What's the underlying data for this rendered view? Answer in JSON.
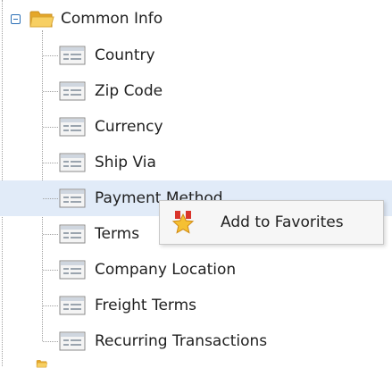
{
  "tree": {
    "root": {
      "label": "Common Info",
      "expanded": true,
      "icon": "folder-open-icon"
    },
    "children": [
      {
        "label": "Country",
        "icon": "form-icon"
      },
      {
        "label": "Zip Code",
        "icon": "form-icon"
      },
      {
        "label": "Currency",
        "icon": "form-icon"
      },
      {
        "label": "Ship Via",
        "icon": "form-icon"
      },
      {
        "label": "Payment Method",
        "icon": "form-icon",
        "selected": true
      },
      {
        "label": "Terms",
        "icon": "form-icon"
      },
      {
        "label": "Company Location",
        "icon": "form-icon"
      },
      {
        "label": "Freight Terms",
        "icon": "form-icon"
      },
      {
        "label": "Recurring Transactions",
        "icon": "form-icon"
      }
    ]
  },
  "context_menu": {
    "items": [
      {
        "label": "Add to Favorites",
        "icon": "favorite-star-icon"
      }
    ]
  },
  "colors": {
    "selected_row": "#e1ebf8",
    "expander_border": "#2b6fb6",
    "menu_background": "#f6f6f6",
    "folder": "#f2c04c"
  }
}
